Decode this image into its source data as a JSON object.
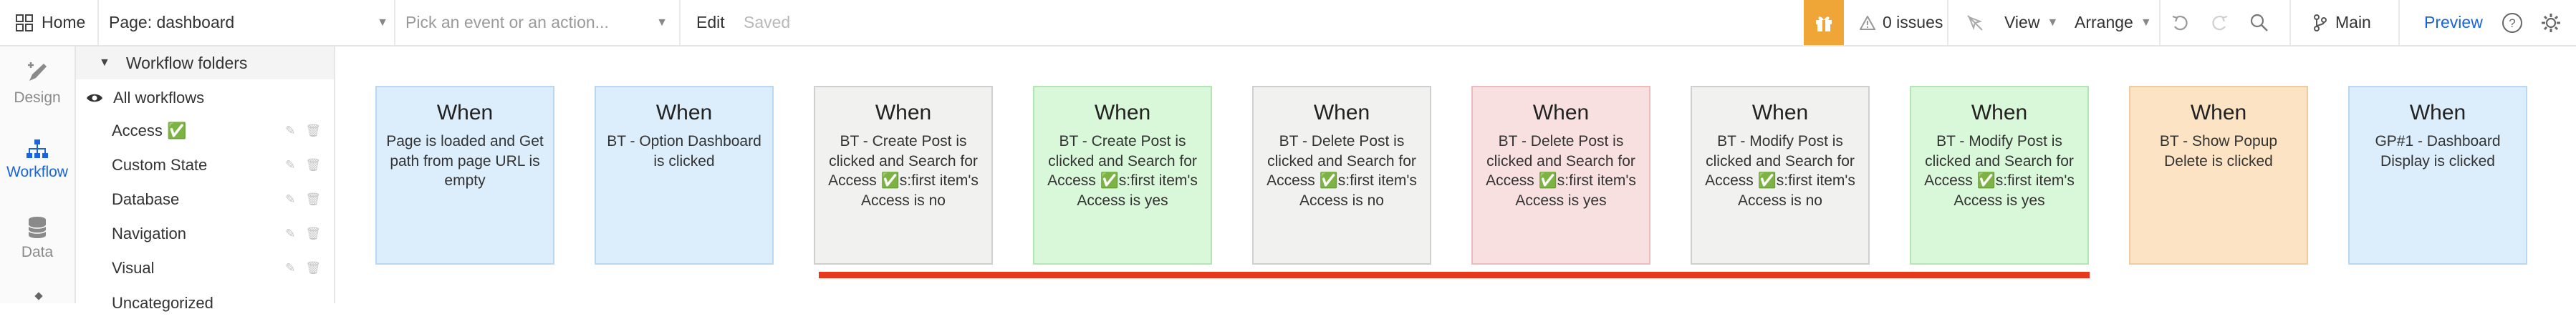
{
  "topbar": {
    "home_label": "Home",
    "page_selector": "Page: dashboard",
    "event_placeholder": "Pick an event or an action...",
    "edit_label": "Edit",
    "saved_label": "Saved",
    "issues_label": "0 issues",
    "view_label": "View",
    "arrange_label": "Arrange",
    "branch_label": "Main",
    "preview_label": "Preview"
  },
  "rail": {
    "items": [
      {
        "label": "Design",
        "icon": "design-brush-icon"
      },
      {
        "label": "Workflow",
        "icon": "workflow-tree-icon"
      },
      {
        "label": "Data",
        "icon": "database-icon"
      }
    ]
  },
  "panel": {
    "header": "Workflow folders",
    "all_workflows": "All workflows",
    "folders": [
      "Access ✅",
      "Custom State",
      "Database",
      "Navigation",
      "Visual"
    ],
    "partial_row": "Uncategorized"
  },
  "cards": [
    {
      "when": "When",
      "text": "Page is loaded and Get path from page URL is empty",
      "color": "blue"
    },
    {
      "when": "When",
      "text": "BT - Option Dashboard is clicked",
      "color": "blue"
    },
    {
      "when": "When",
      "text": "BT - Create Post is clicked and Search for Access ✅s:first item's Access is no",
      "color": "gray"
    },
    {
      "when": "When",
      "text": "BT - Create Post is clicked and Search for Access ✅s:first item's Access is yes",
      "color": "green"
    },
    {
      "when": "When",
      "text": "BT - Delete Post is clicked and Search for Access ✅s:first item's Access is no",
      "color": "gray"
    },
    {
      "when": "When",
      "text": "BT - Delete Post is clicked and Search for Access ✅s:first item's Access is yes",
      "color": "red"
    },
    {
      "when": "When",
      "text": "BT - Modify Post is clicked and Search for Access ✅s:first item's Access is no",
      "color": "gray"
    },
    {
      "when": "When",
      "text": "BT - Modify Post is clicked and Search for Access ✅s:first item's Access is yes",
      "color": "green"
    },
    {
      "when": "When",
      "text": "BT - Show Popup Delete is clicked",
      "color": "orange"
    },
    {
      "when": "When",
      "text": "GP#1 - Dashboard Display is clicked",
      "color": "blue"
    }
  ],
  "card_colors": {
    "blue": {
      "bg": "#dcedfb",
      "border": "#b8d8f3"
    },
    "gray": {
      "bg": "#f1f1f0",
      "border": "#cfcfcf"
    },
    "green": {
      "bg": "#d9f7d9",
      "border": "#b4e6b4"
    },
    "red": {
      "bg": "#f9e0e0",
      "border": "#ecbcbc"
    },
    "orange": {
      "bg": "#fbe3c4",
      "border": "#f0cb9d"
    }
  },
  "colors": {
    "accent": "#1a64e0",
    "gift": "#f0a637",
    "error_line": "#e8381c"
  }
}
